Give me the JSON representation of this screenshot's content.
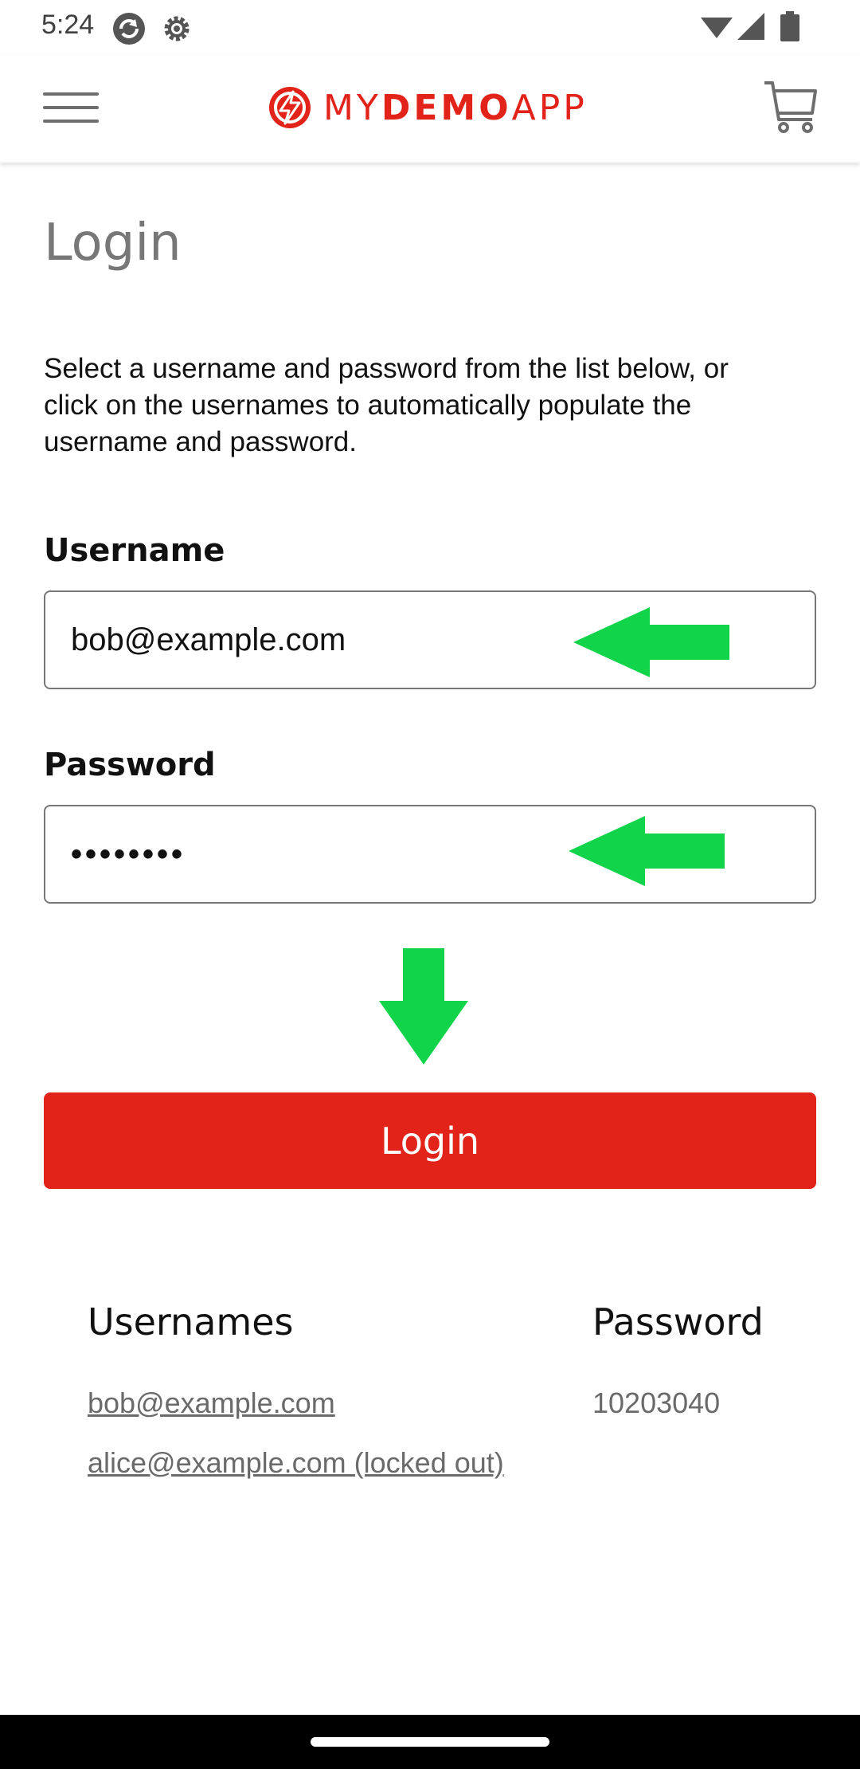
{
  "status_bar": {
    "time": "5:24",
    "icons": [
      "sync-icon",
      "settings-icon",
      "wifi-icon",
      "signal-icon",
      "battery-icon"
    ]
  },
  "header": {
    "logo_text_part1": "MY",
    "logo_text_part2": "DEMO",
    "logo_text_part3": "APP",
    "icons": [
      "menu-icon",
      "logo-icon",
      "cart-icon"
    ]
  },
  "page": {
    "title": "Login",
    "intro": "Select a username and password from the list below, or click on the usernames to automatically populate the username and password."
  },
  "form": {
    "username_label": "Username",
    "username_value": "bob@example.com",
    "password_label": "Password",
    "password_value": "••••••••",
    "login_button": "Login"
  },
  "credentials": {
    "usernames_header": "Usernames",
    "password_header": "Password",
    "usernames": [
      "bob@example.com",
      "alice@example.com (locked out)"
    ],
    "passwords": [
      "10203040"
    ]
  },
  "colors": {
    "brand": "#e2231a",
    "annotation_arrow": "#12d44a"
  }
}
